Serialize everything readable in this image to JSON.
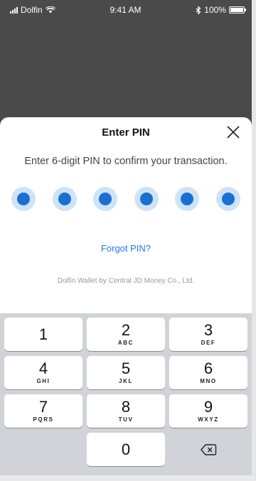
{
  "status_bar": {
    "carrier": "Dolfin",
    "time": "9:41 AM",
    "battery": "100%"
  },
  "sheet": {
    "title": "Enter PIN",
    "instruction": "Enter 6-digit PIN to confirm your transaction.",
    "pin_length": 6,
    "pin_filled": 6,
    "forgot_label": "Forgot PIN?",
    "footer": "Dolfin Wallet by Central JD Money Co., Ltd."
  },
  "keypad": {
    "keys": [
      {
        "num": "1",
        "letters": ""
      },
      {
        "num": "2",
        "letters": "ABC"
      },
      {
        "num": "3",
        "letters": "DEF"
      },
      {
        "num": "4",
        "letters": "GHI"
      },
      {
        "num": "5",
        "letters": "JKL"
      },
      {
        "num": "6",
        "letters": "MNO"
      },
      {
        "num": "7",
        "letters": "PQRS"
      },
      {
        "num": "8",
        "letters": "TUV"
      },
      {
        "num": "9",
        "letters": "WXYZ"
      },
      {
        "num": "0",
        "letters": ""
      }
    ],
    "backspace_icon": "backspace-icon"
  },
  "colors": {
    "accent": "#1a6fd2",
    "pin_halo": "#cfe3f7",
    "link": "#1f7ae0",
    "dim_background": "#4a4a4a",
    "keypad_background": "#d1d3d8"
  }
}
